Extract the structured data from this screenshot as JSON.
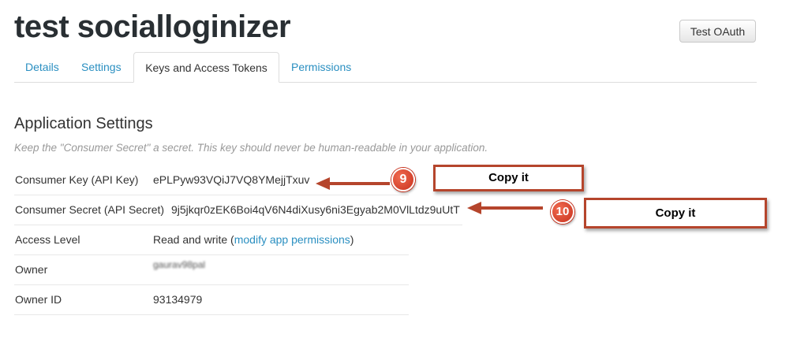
{
  "app": {
    "title": "test socialloginizer"
  },
  "header": {
    "test_oauth_label": "Test OAuth"
  },
  "tabs": [
    {
      "label": "Details"
    },
    {
      "label": "Settings"
    },
    {
      "label": "Keys and Access Tokens"
    },
    {
      "label": "Permissions"
    }
  ],
  "section": {
    "title": "Application Settings",
    "hint": "Keep the \"Consumer Secret\" a secret. This key should never be human-readable in your application."
  },
  "settings": {
    "consumer_key": {
      "label": "Consumer Key (API Key)",
      "value": "ePLPyw93VQiJ7VQ8YMejjTxuv"
    },
    "consumer_secret": {
      "label": "Consumer Secret (API Secret)",
      "value": "9j5jkqr0zEK6Boi4qV6N4diXusy6ni3Egyab2M0VlLtdz9uUtT"
    },
    "access_level": {
      "label": "Access Level",
      "value": "Read and write (",
      "link": "modify app permissions",
      "suffix": ")"
    },
    "owner": {
      "label": "Owner",
      "value": "gaurav98pal"
    },
    "owner_id": {
      "label": "Owner ID",
      "value": "93134979"
    }
  },
  "annotations": {
    "badge_1": "9",
    "badge_2": "10",
    "copy_1": "Copy it",
    "copy_2": "Copy it",
    "color": "#b5452c"
  }
}
